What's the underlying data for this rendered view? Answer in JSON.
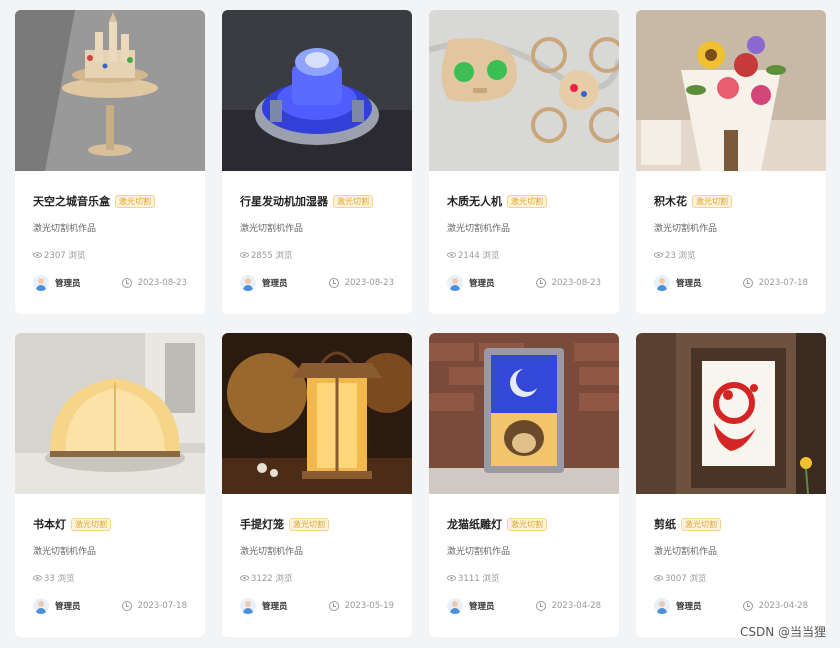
{
  "watermark": "CSDN @当当狸",
  "cards": [
    {
      "title": "天空之城音乐盒",
      "tag": "激光切割",
      "desc": "激光切割机作品",
      "views": "2307 浏览",
      "author": "管理员",
      "date": "2023-08-23",
      "image": "castle-music-box"
    },
    {
      "title": "行星发动机加湿器",
      "tag": "激光切割",
      "desc": "激光切割机作品",
      "views": "2855 浏览",
      "author": "管理员",
      "date": "2023-08-23",
      "image": "planet-engine-humidifier"
    },
    {
      "title": "木质无人机",
      "tag": "激光切割",
      "desc": "激光切割机作品",
      "views": "2144 浏览",
      "author": "管理员",
      "date": "2023-08-23",
      "image": "wooden-drone"
    },
    {
      "title": "积木花",
      "tag": "激光切割",
      "desc": "激光切割机作品",
      "views": "23 浏览",
      "author": "管理员",
      "date": "2023-07-18",
      "image": "block-flower-bouquet"
    },
    {
      "title": "书本灯",
      "tag": "激光切割",
      "desc": "激光切割机作品",
      "views": "33 浏览",
      "author": "管理员",
      "date": "2023-07-18",
      "image": "book-lamp"
    },
    {
      "title": "手提灯笼",
      "tag": "激光切割",
      "desc": "激光切割机作品",
      "views": "3122 浏览",
      "author": "管理员",
      "date": "2023-05-19",
      "image": "hand-lantern"
    },
    {
      "title": "龙猫纸雕灯",
      "tag": "激光切割",
      "desc": "激光切割机作品",
      "views": "3111 浏览",
      "author": "管理员",
      "date": "2023-04-28",
      "image": "totoro-paper-lamp"
    },
    {
      "title": "剪纸",
      "tag": "激光切割",
      "desc": "激光切割机作品",
      "views": "3007 浏览",
      "author": "管理员",
      "date": "2023-04-28",
      "image": "paper-cut"
    }
  ]
}
